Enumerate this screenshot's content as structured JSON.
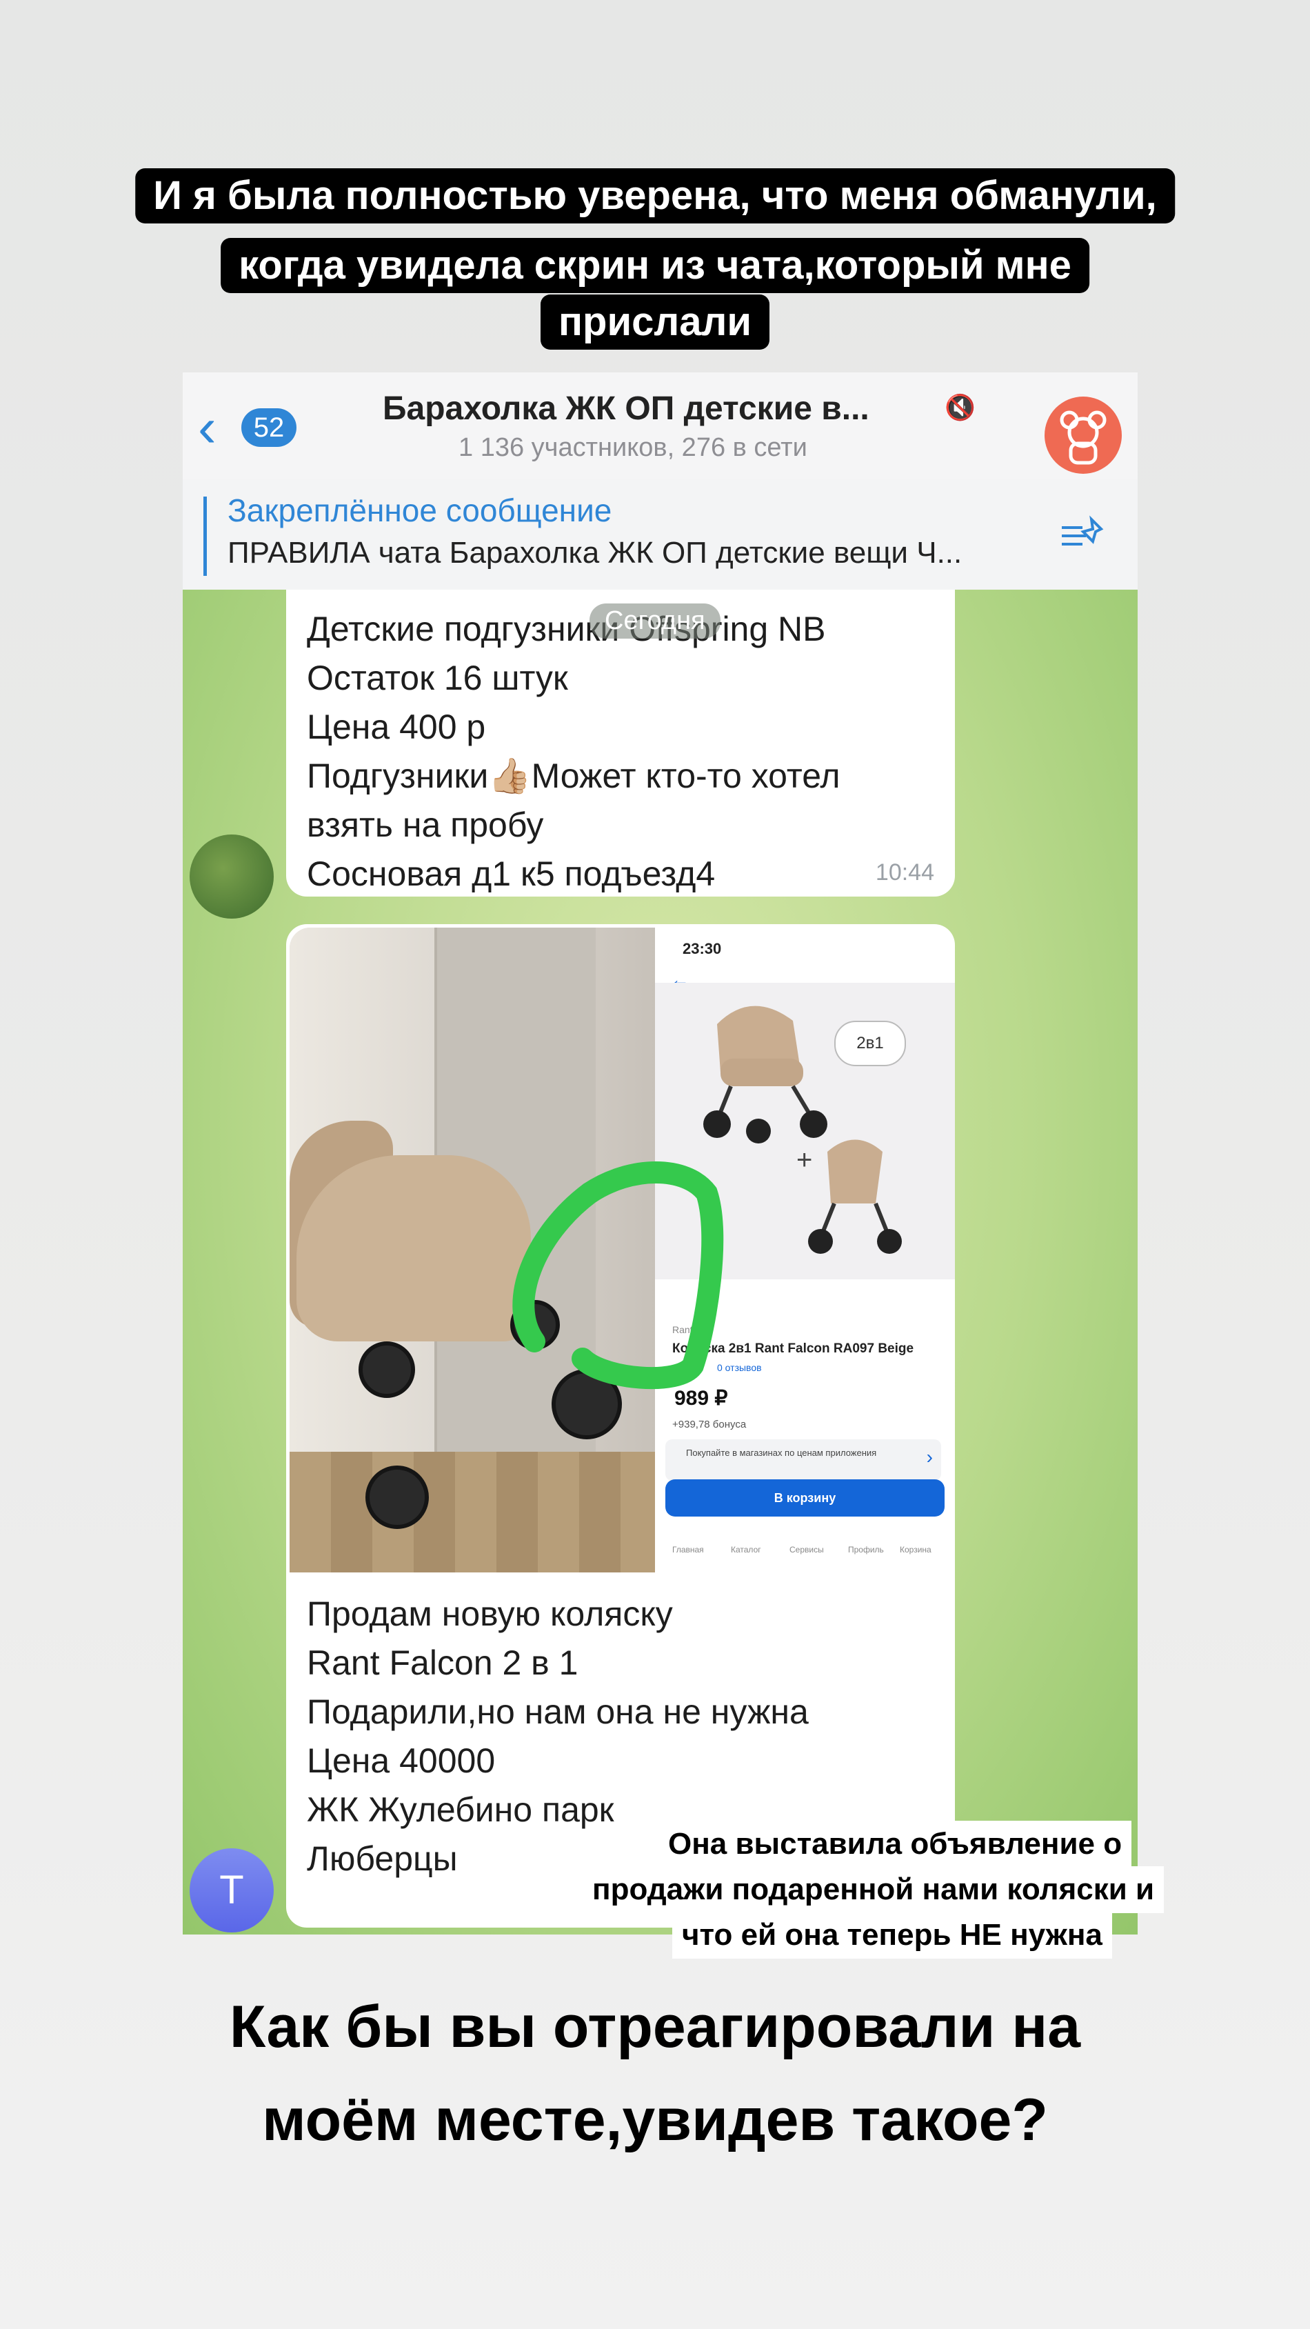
{
  "top_caption": {
    "line1": "И я была полностью уверена, что меня обманули,",
    "line2": "когда увидела скрин из чата,который мне",
    "line3": "прислали"
  },
  "chat_header": {
    "back_count": "52",
    "title": "Барахолка ЖК ОП детские в...",
    "mute_glyph": "🔇",
    "subtitle": "1 136 участников, 276 в сети"
  },
  "pinned": {
    "title": "Закреплённое сообщение",
    "text": "ПРАВИЛА чата Барахолка ЖК ОП детские вещи Ч..."
  },
  "date_chip": "Сегодня",
  "message1": {
    "lines": [
      "Детские подгузники Offspring NB",
      "Остаток 16 штук",
      "Цена 400 р",
      "Подгузники👍🏼Может кто-то хотел",
      "взять на пробу",
      "Сосновая д1 к5 подъезд4"
    ],
    "time": "10:44"
  },
  "product_screenshot": {
    "status_time": "23:30",
    "badge": "2в1",
    "brand": "Rant",
    "title": "Коляска 2в1 Rant Falcon RA097 Beige",
    "reviews": "0 отзывов",
    "price": "989 ₽",
    "bonus": "+939,78 бонуса",
    "shop_text": "Покупайте в магазинах по ценам приложения",
    "cart_button": "В корзину",
    "nav": [
      "Главная",
      "Каталог",
      "Сервисы",
      "Профиль",
      "Корзина"
    ]
  },
  "message2": {
    "lines": [
      "Продам новую коляску",
      "Rant Falcon 2 в 1",
      "Подарили,но нам она не нужна",
      "Цена 40000",
      "ЖК Жулебино парк",
      "Люберцы"
    ]
  },
  "sender_initial": "Т",
  "overlay_caption": {
    "line1": "Она выставила объявление о",
    "line2": "продажи подаренной нами коляски и",
    "line3": "что ей она теперь НЕ нужна"
  },
  "question": {
    "line1": "Как бы вы отреагировали на",
    "line2": "моём месте,увидев такое?"
  },
  "colors": {
    "telegram_blue": "#2f86d6",
    "highlight_green": "#35c94d",
    "cart_blue": "#1466d8"
  }
}
